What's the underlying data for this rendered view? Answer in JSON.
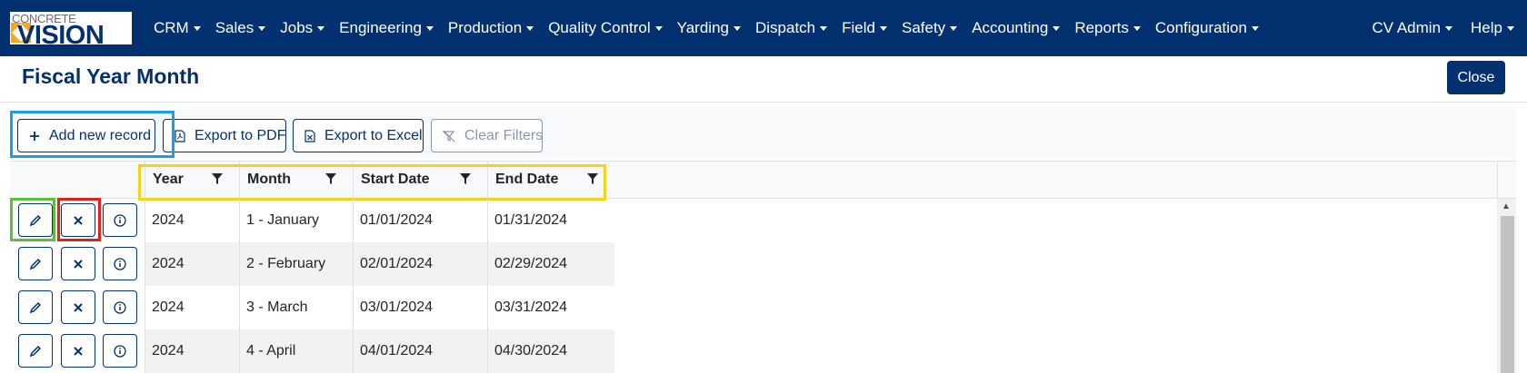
{
  "logo": {
    "top_text": "CONCRETE",
    "main_text": "VISION"
  },
  "nav": {
    "items": [
      "CRM",
      "Sales",
      "Jobs",
      "Engineering",
      "Production",
      "Quality Control",
      "Yarding",
      "Dispatch",
      "Field",
      "Safety",
      "Accounting",
      "Reports",
      "Configuration"
    ],
    "right": [
      "CV Admin",
      "Help"
    ]
  },
  "page": {
    "title": "Fiscal Year Month",
    "close_label": "Close"
  },
  "toolbar": {
    "add_label": "Add new record",
    "pdf_label": "Export to PDF",
    "excel_label": "Export to Excel",
    "clear_label": "Clear Filters"
  },
  "grid": {
    "columns": [
      "Year",
      "Month",
      "Start Date",
      "End Date"
    ],
    "rows": [
      [
        "2024",
        "1 - January",
        "01/01/2024",
        "01/31/2024"
      ],
      [
        "2024",
        "2 - February",
        "02/01/2024",
        "02/29/2024"
      ],
      [
        "2024",
        "3 - March",
        "03/01/2024",
        "03/31/2024"
      ],
      [
        "2024",
        "4 - April",
        "04/01/2024",
        "04/30/2024"
      ]
    ]
  },
  "colors": {
    "brand": "#03306e",
    "highlight_blue": "#1e9bf0",
    "highlight_yellow": "#f5d31b",
    "highlight_green": "#5cbf3a",
    "highlight_red": "#e3211c"
  }
}
